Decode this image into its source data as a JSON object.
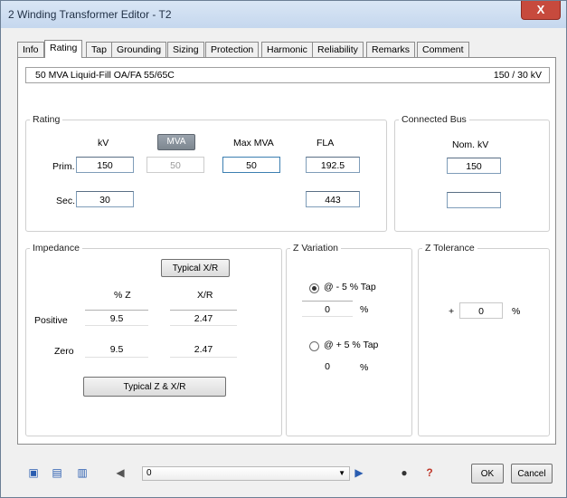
{
  "window": {
    "title": "2 Winding Transformer Editor - T2",
    "close_label": "X"
  },
  "tabs": [
    "Info",
    "Rating",
    "Tap",
    "Grounding",
    "Sizing",
    "Protection",
    "Harmonic",
    "Reliability",
    "Remarks",
    "Comment"
  ],
  "active_tab": "Rating",
  "infobar": {
    "left": "50 MVA Liquid-Fill OA/FA 55/65C",
    "right": "150 / 30 kV"
  },
  "rating": {
    "legend": "Rating",
    "col_kv": "kV",
    "col_mva_button": "MVA",
    "col_max_mva": "Max MVA",
    "col_fla": "FLA",
    "prim_label": "Prim.",
    "sec_label": "Sec.",
    "prim_kv": "150",
    "prim_mva": "50",
    "max_mva": "50",
    "prim_fla": "192.5",
    "sec_kv": "30",
    "sec_fla": "443"
  },
  "connected_bus": {
    "legend": "Connected Bus",
    "nom_kv_label": "Nom. kV",
    "prim_nom_kv": "150",
    "sec_nom_kv": ""
  },
  "impedance": {
    "legend": "Impedance",
    "typical_xr_button": "Typical X/R",
    "col_z": "% Z",
    "col_xr": "X/R",
    "positive_label": "Positive",
    "zero_label": "Zero",
    "positive_z": "9.5",
    "positive_xr": "2.47",
    "zero_z": "9.5",
    "zero_xr": "2.47",
    "typical_z_button": "Typical Z & X/R"
  },
  "z_variation": {
    "legend": "Z Variation",
    "option1_label": "@ - 5 % Tap",
    "option1_value": "0",
    "option1_unit": "%",
    "option2_label": "@ + 5 % Tap",
    "option2_value": "0",
    "option2_unit": "%"
  },
  "z_tolerance": {
    "legend": "Z Tolerance",
    "sign": "+",
    "value": "0",
    "unit": "%"
  },
  "bottom": {
    "ok_label": "OK",
    "cancel_label": "Cancel",
    "combo_value": "0"
  }
}
